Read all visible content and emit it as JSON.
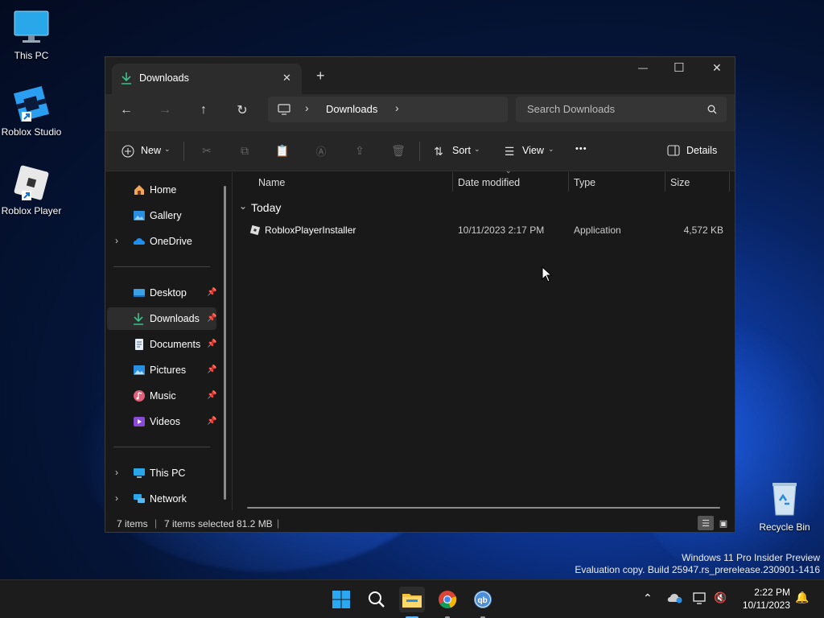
{
  "desktop": {
    "icons": [
      {
        "label": "This PC"
      },
      {
        "label": "Roblox Studio"
      },
      {
        "label": "Roblox Player"
      },
      {
        "label": "Recycle Bin"
      }
    ],
    "watermark": {
      "line1": "Windows 11 Pro Insider Preview",
      "line2": "Evaluation copy. Build 25947.rs_prerelease.230901-1416"
    }
  },
  "window": {
    "tab_title": "Downloads",
    "tab_close": "✕",
    "new_tab": "+",
    "controls": {
      "minimize": "—",
      "maximize": "☐",
      "close": "✕"
    },
    "address": {
      "root_icon": "computer-icon",
      "sep1": "›",
      "segment": "Downloads",
      "sep2": "›"
    },
    "search": {
      "placeholder": "Search Downloads"
    },
    "toolbar": {
      "new_label": "New",
      "sort_label": "Sort",
      "view_label": "View",
      "more_label": "•••",
      "details_label": "Details"
    },
    "sidebar": {
      "items": [
        {
          "label": "Home"
        },
        {
          "label": "Gallery"
        },
        {
          "label": "OneDrive"
        },
        {
          "label": "Desktop"
        },
        {
          "label": "Downloads"
        },
        {
          "label": "Documents"
        },
        {
          "label": "Pictures"
        },
        {
          "label": "Music"
        },
        {
          "label": "Videos"
        },
        {
          "label": "This PC"
        },
        {
          "label": "Network"
        }
      ]
    },
    "columns": {
      "name": "Name",
      "date": "Date modified",
      "type": "Type",
      "size": "Size"
    },
    "group": {
      "label": "Today"
    },
    "files": [
      {
        "name": "RobloxPlayerInstaller",
        "date": "10/11/2023 2:17 PM",
        "type": "Application",
        "size": "4,572 KB"
      }
    ],
    "status": {
      "count": "7 items",
      "selected": "7 items selected",
      "size": "81.2 MB"
    }
  },
  "taskbar": {
    "clock": {
      "time": "2:22 PM",
      "date": "10/11/2023"
    }
  },
  "colors": {
    "accent": "#1e90ff",
    "window_bg": "#191919",
    "taskbar_bg": "#1c1c1c"
  }
}
